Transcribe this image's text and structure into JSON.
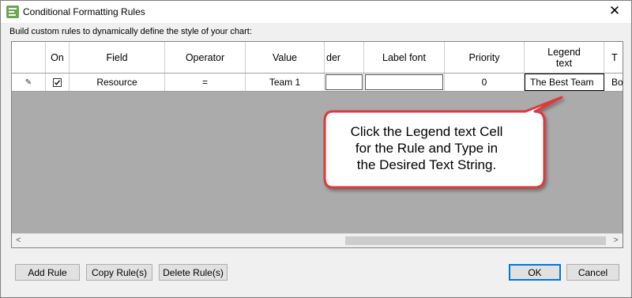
{
  "window": {
    "title": "Conditional Formatting Rules",
    "close_glyph": "✕"
  },
  "subtitle": "Build custom rules to dynamically define the style of your chart:",
  "grid": {
    "columns": [
      "",
      "On",
      "Field",
      "Operator",
      "Value",
      "der",
      "Label font",
      "Priority",
      "Legend text",
      "T"
    ],
    "row": {
      "marker": "✎",
      "on": true,
      "field": "Resource",
      "operator": "=",
      "value": "Team 1",
      "border": "",
      "label_font": "",
      "priority": "0",
      "legend_text": "The Best Team",
      "extra": "Bo"
    },
    "scroll_left": "<",
    "scroll_right": ">"
  },
  "callout": {
    "line1": "Click the Legend text Cell",
    "line2": "for the Rule and Type in",
    "line3": "the Desired Text String.",
    "border_color": "#e0393b"
  },
  "buttons": {
    "add_rule": "Add Rule",
    "copy_rules": "Copy Rule(s)",
    "delete_rules": "Delete Rule(s)",
    "ok": "OK",
    "cancel": "Cancel"
  }
}
